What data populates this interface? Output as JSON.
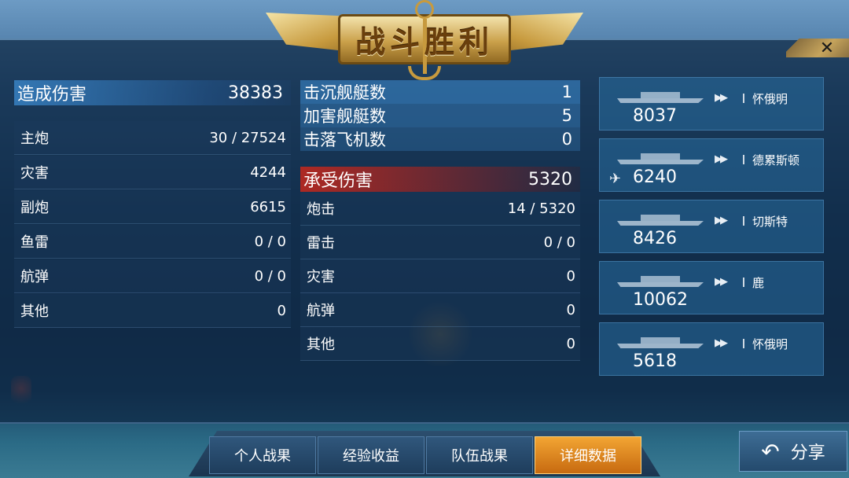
{
  "title": "战斗胜利",
  "close_symbol": "✕",
  "damage_dealt": {
    "label": "造成伤害",
    "total": "38383",
    "rows": [
      {
        "label": "主炮",
        "value": "30 / 27524"
      },
      {
        "label": "灾害",
        "value": "4244"
      },
      {
        "label": "副炮",
        "value": "6615"
      },
      {
        "label": "鱼雷",
        "value": "0 / 0"
      },
      {
        "label": "航弹",
        "value": "0 / 0"
      },
      {
        "label": "其他",
        "value": "0"
      }
    ]
  },
  "kills": [
    {
      "label": "击沉舰艇数",
      "value": "1"
    },
    {
      "label": "加害舰艇数",
      "value": "5"
    },
    {
      "label": "击落飞机数",
      "value": "0"
    }
  ],
  "damage_received": {
    "label": "承受伤害",
    "total": "5320",
    "rows": [
      {
        "label": "炮击",
        "value": "14 / 5320"
      },
      {
        "label": "雷击",
        "value": "0 / 0"
      },
      {
        "label": "灾害",
        "value": "0"
      },
      {
        "label": "航弹",
        "value": "0"
      },
      {
        "label": "其他",
        "value": "0"
      }
    ]
  },
  "ships": [
    {
      "name": "怀俄明",
      "damage": "8037",
      "icon": "speed-arrow-icon"
    },
    {
      "name": "德累斯顿",
      "damage": "6240",
      "icon": "speed-arrow-icon",
      "badge": "aircraft-icon"
    },
    {
      "name": "切斯特",
      "damage": "8426",
      "icon": "speed-arrow-icon"
    },
    {
      "name": "鹿",
      "damage": "10062",
      "icon": "speed-arrow-icon"
    },
    {
      "name": "怀俄明",
      "damage": "5618",
      "icon": "speed-arrow-icon"
    }
  ],
  "tabs": [
    {
      "label": "个人战果"
    },
    {
      "label": "经验收益"
    },
    {
      "label": "队伍战果"
    },
    {
      "label": "详细数据",
      "active": true
    }
  ],
  "share": {
    "label": "分享",
    "icon": "back-arrow-icon"
  },
  "colors": {
    "accent": "#f2a533",
    "red": "#be281e",
    "blue": "#3c8cd2",
    "gold": "#c79a3e"
  }
}
